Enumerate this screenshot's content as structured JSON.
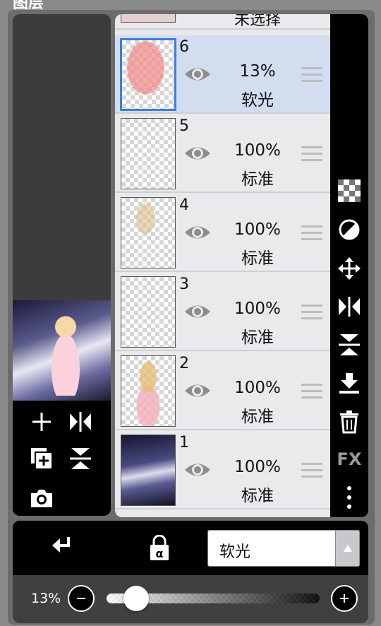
{
  "header": {
    "title": "图层"
  },
  "top_layer": {
    "label": "未选择"
  },
  "layers": [
    {
      "number": "6",
      "opacity": "13%",
      "blend": "软光"
    },
    {
      "number": "5",
      "opacity": "100%",
      "blend": "标准"
    },
    {
      "number": "4",
      "opacity": "100%",
      "blend": "标准"
    },
    {
      "number": "3",
      "opacity": "100%",
      "blend": "标准"
    },
    {
      "number": "2",
      "opacity": "100%",
      "blend": "标准"
    },
    {
      "number": "1",
      "opacity": "100%",
      "blend": "标准"
    }
  ],
  "toolbar": {
    "fx_label": "FX"
  },
  "bottom": {
    "blend_mode": "软光"
  },
  "opacity": {
    "label": "13%",
    "value": 0.13
  },
  "colors": {
    "selected_row": "#d2ddf0",
    "selection_border": "#3b7de0",
    "panel_bg": "#000000"
  },
  "icons": [
    "checkerboard-icon",
    "circle-half-icon",
    "move-icon",
    "flip-horizontal-icon",
    "flip-vertical-icon",
    "merge-down-icon",
    "trash-icon",
    "more-icon",
    "add-icon",
    "duplicate-icon",
    "camera-icon",
    "eye-icon",
    "drag-handle-icon",
    "clipping-icon",
    "alpha-lock-icon"
  ]
}
